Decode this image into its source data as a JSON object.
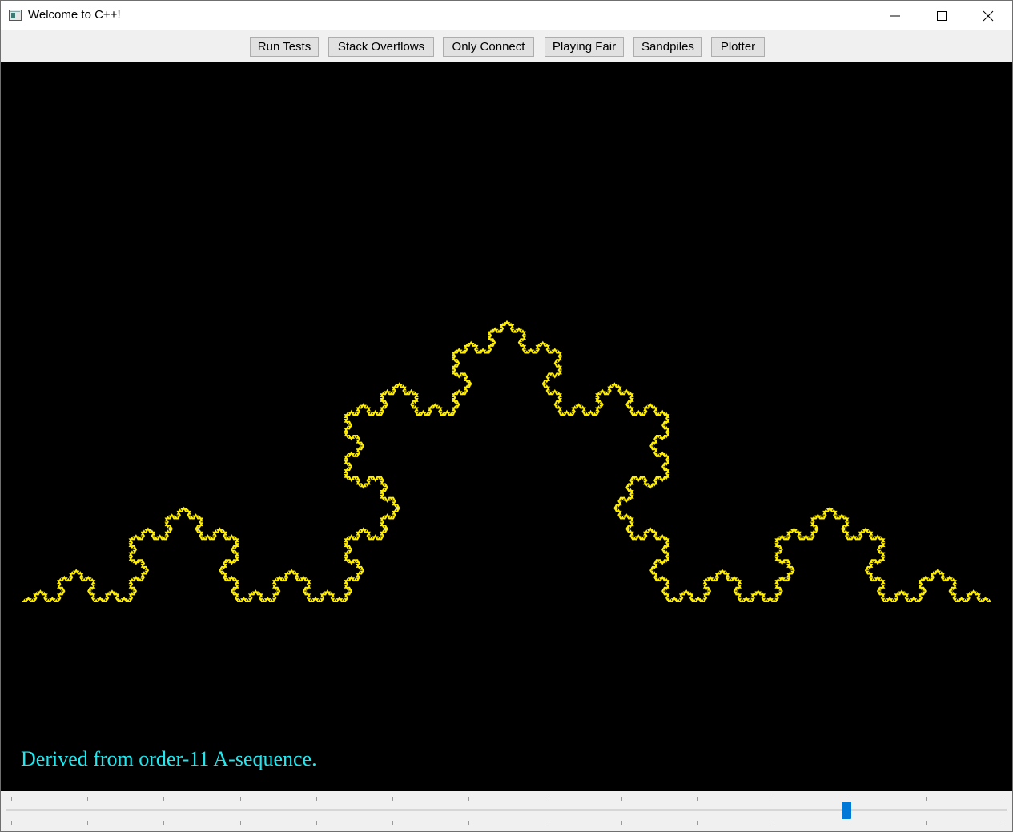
{
  "window": {
    "title": "Welcome to C++!",
    "controls": {
      "minimize": "minimize-icon",
      "maximize": "maximize-icon",
      "close": "close-icon"
    }
  },
  "toolbar": {
    "buttons": [
      {
        "label": "Run Tests"
      },
      {
        "label": "Stack Overflows"
      },
      {
        "label": "Only Connect"
      },
      {
        "label": "Playing Fair"
      },
      {
        "label": "Sandpiles"
      },
      {
        "label": "Plotter"
      }
    ]
  },
  "canvas": {
    "background": "#000000",
    "curve_color": "#ffee00",
    "caption": "Derived from order-11 A-sequence.",
    "caption_color": "#1ee8f0"
  },
  "slider": {
    "value_fraction": 0.84,
    "thumb_color": "#0078d7"
  }
}
